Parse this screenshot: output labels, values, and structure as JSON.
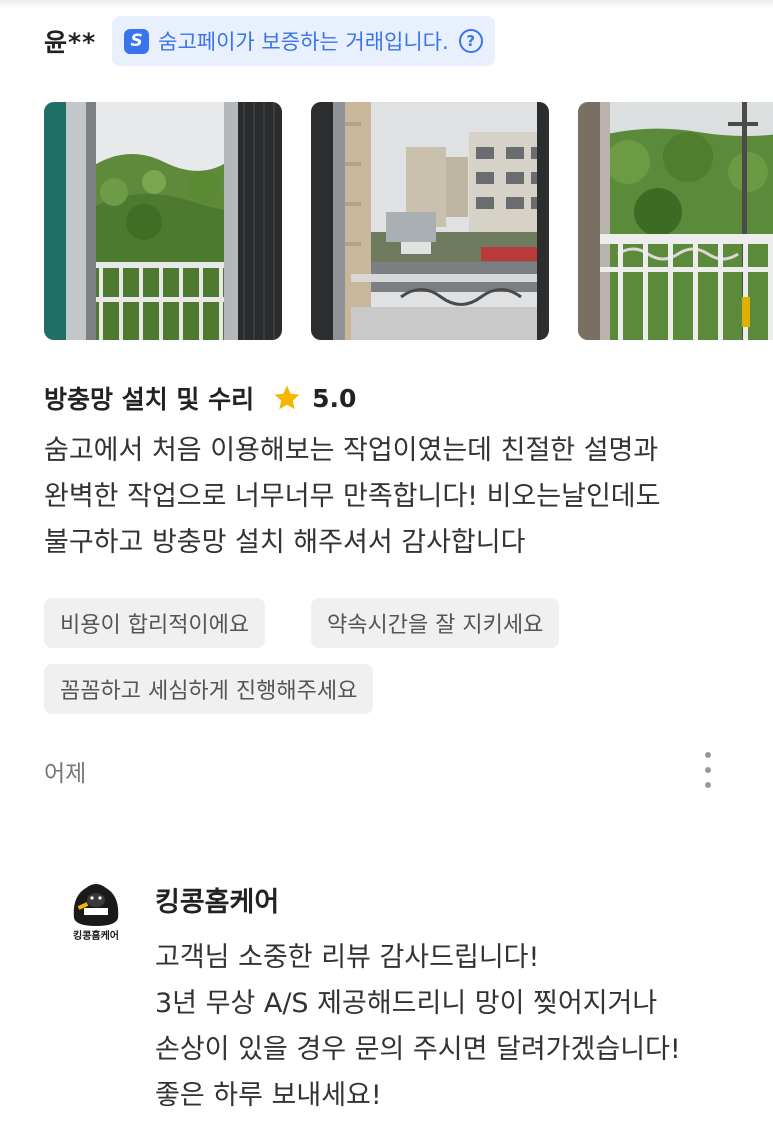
{
  "review": {
    "reviewer": "윤**",
    "pay_badge": {
      "logo": "S",
      "text": "숨고페이가 보증하는 거래입니다.",
      "help_icon": "?",
      "color": "#3a74ec"
    },
    "photos": [
      {
        "icon": "photo-window-view-hills"
      },
      {
        "icon": "photo-window-view-buildings"
      },
      {
        "icon": "photo-balcony-view-trees"
      }
    ],
    "service_name": "방충망 설치 및 수리",
    "rating": "5.0",
    "star_color": "#f5b700",
    "text_lines": [
      "숨고에서 처음 이용해보는 작업이였는데 친절한 설명과",
      "완벽한 작업으로 너무너무 만족합니다! 비오는날인데도",
      "불구하고 방충망 설치 해주셔서 감사합니다"
    ],
    "tags": [
      "비용이 합리적이에요",
      "약속시간을 잘 지키세요",
      "꼼꼼하고 세심하게 진행해주세요"
    ],
    "date": "어제"
  },
  "reply": {
    "brand": "킹콩홈케어",
    "avatar_label": "킹콩홈케어",
    "text_lines": [
      "고객님 소중한 리뷰 감사드립니다!",
      "3년 무상 A/S 제공해드리니 망이 찢어지거나",
      "손상이 있을 경우 문의 주시면 달려가겠습니다!",
      "좋은 하루 보내세요!"
    ]
  }
}
